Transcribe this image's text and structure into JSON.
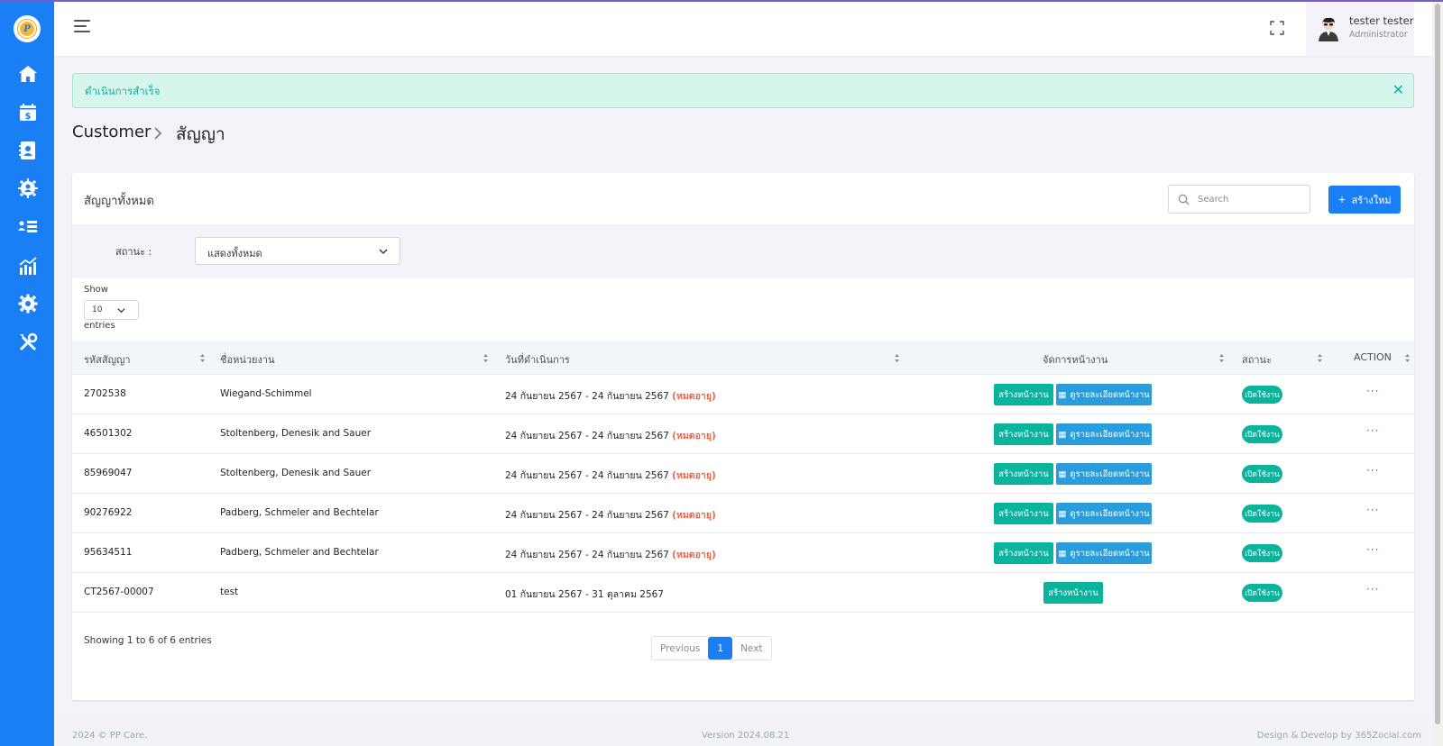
{
  "colors": {
    "primary": "#1a7ff5",
    "success": "#0ab39c",
    "info": "#299cdb",
    "danger": "#f06548"
  },
  "header": {
    "user_name": "tester tester",
    "user_role": "Administrator"
  },
  "alert": {
    "text": "ดำเนินการสำเร็จ"
  },
  "breadcrumb": {
    "parent": "Customer",
    "current": "สัญญา"
  },
  "card": {
    "title": "สัญญาทั้งหมด",
    "search_placeholder": "Search",
    "new_button": "สร้างใหม่"
  },
  "filter": {
    "label": "สถานะ :",
    "value": "แสดงทั้งหมด"
  },
  "length": {
    "show": "Show",
    "value": "10",
    "entries": "entries"
  },
  "table": {
    "columns": [
      "รหัสสัญญา",
      "ชื่อหน่วยงาน",
      "วันที่ดำเนินการ",
      "จัดการหน้างาน",
      "สถานะ",
      "ACTION"
    ],
    "rows": [
      {
        "code": "2702538",
        "name": "Wiegand-Schimmel",
        "date": "24 กันยายน 2567 - 24 กันยายน 2567",
        "expired": "(หมดอายุ)",
        "create": "สร้างหน้างาน",
        "detail": "ดูรายละเอียดหน้างาน",
        "status": "เปิดใช้งาน",
        "action": "···"
      },
      {
        "code": "46501302",
        "name": "Stoltenberg, Denesik and Sauer",
        "date": "24 กันยายน 2567 - 24 กันยายน 2567",
        "expired": "(หมดอายุ)",
        "create": "สร้างหน้างาน",
        "detail": "ดูรายละเอียดหน้างาน",
        "status": "เปิดใช้งาน",
        "action": "···"
      },
      {
        "code": "85969047",
        "name": "Stoltenberg, Denesik and Sauer",
        "date": "24 กันยายน 2567 - 24 กันยายน 2567",
        "expired": "(หมดอายุ)",
        "create": "สร้างหน้างาน",
        "detail": "ดูรายละเอียดหน้างาน",
        "status": "เปิดใช้งาน",
        "action": "···"
      },
      {
        "code": "90276922",
        "name": "Padberg, Schmeler and Bechtelar",
        "date": "24 กันยายน 2567 - 24 กันยายน 2567",
        "expired": "(หมดอายุ)",
        "create": "สร้างหน้างาน",
        "detail": "ดูรายละเอียดหน้างาน",
        "status": "เปิดใช้งาน",
        "action": "···"
      },
      {
        "code": "95634511",
        "name": "Padberg, Schmeler and Bechtelar",
        "date": "24 กันยายน 2567 - 24 กันยายน 2567",
        "expired": "(หมดอายุ)",
        "create": "สร้างหน้างาน",
        "detail": "ดูรายละเอียดหน้างาน",
        "status": "เปิดใช้งาน",
        "action": "···"
      },
      {
        "code": "CT2567-00007",
        "name": "test",
        "date": "01 กันยายน 2567 - 31 ตุลาคม 2567",
        "create": "สร้างหน้างาน",
        "status": "เปิดใช้งาน",
        "action": "···"
      }
    ]
  },
  "pagination": {
    "info": "Showing 1 to 6 of 6 entries",
    "previous": "Previous",
    "page": "1",
    "next": "Next"
  },
  "footer": {
    "copyright": "2024 © PP Care.",
    "version": "Version 2024.08.21",
    "credit": "Design & Develop by 365Zocial.com"
  },
  "sidebar_icons": [
    "home-icon",
    "billing-calendar-icon",
    "contact-book-icon",
    "team-gear-icon",
    "list-icon",
    "chart-icon",
    "settings-icon",
    "tools-icon"
  ]
}
